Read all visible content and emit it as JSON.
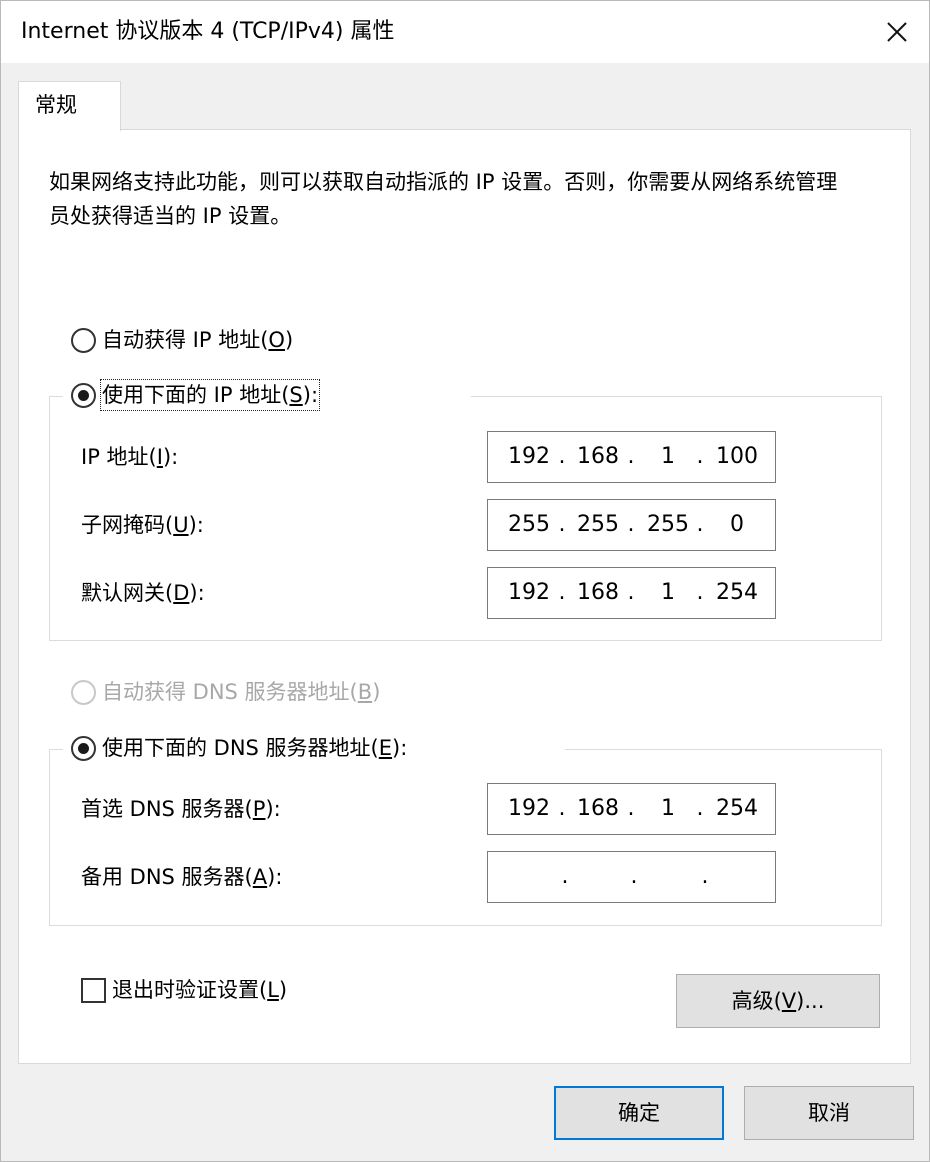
{
  "window": {
    "title": "Internet 协议版本 4 (TCP/IPv4) 属性",
    "close_icon": "close-icon"
  },
  "tabs": [
    {
      "label": "常规",
      "active": true
    }
  ],
  "description": "如果网络支持此功能，则可以获取自动指派的 IP 设置。否则，你需要从网络系统管理员处获得适当的 IP 设置。",
  "ip_section": {
    "auto_option": {
      "text": "自动获得 IP 地址(",
      "key": "O",
      "suffix": ")",
      "checked": false
    },
    "manual_option": {
      "text": "使用下面的 IP 地址(",
      "key": "S",
      "suffix": "):",
      "checked": true
    },
    "fields": [
      {
        "label_text": "IP 地址(",
        "key": "I",
        "label_suffix": "):",
        "segments": [
          "192",
          "168",
          "1",
          "100"
        ]
      },
      {
        "label_text": "子网掩码(",
        "key": "U",
        "label_suffix": "):",
        "segments": [
          "255",
          "255",
          "255",
          "0"
        ]
      },
      {
        "label_text": "默认网关(",
        "key": "D",
        "label_suffix": "):",
        "segments": [
          "192",
          "168",
          "1",
          "254"
        ]
      }
    ]
  },
  "dns_section": {
    "auto_option": {
      "text": "自动获得 DNS 服务器地址(",
      "key": "B",
      "suffix": ")",
      "checked": false,
      "disabled": true
    },
    "manual_option": {
      "text": "使用下面的 DNS 服务器地址(",
      "key": "E",
      "suffix": "):",
      "checked": true
    },
    "fields": [
      {
        "label_text": "首选 DNS 服务器(",
        "key": "P",
        "label_suffix": "):",
        "segments": [
          "192",
          "168",
          "1",
          "254"
        ]
      },
      {
        "label_text": "备用 DNS 服务器(",
        "key": "A",
        "label_suffix": "):",
        "segments": [
          "",
          "",
          "",
          ""
        ]
      }
    ]
  },
  "validate_checkbox": {
    "text": "退出时验证设置(",
    "key": "L",
    "suffix": ")",
    "checked": false
  },
  "buttons": {
    "advanced": {
      "text": "高级(",
      "key": "V",
      "suffix": ")..."
    },
    "ok": "确定",
    "cancel": "取消"
  },
  "ip_separator": "."
}
